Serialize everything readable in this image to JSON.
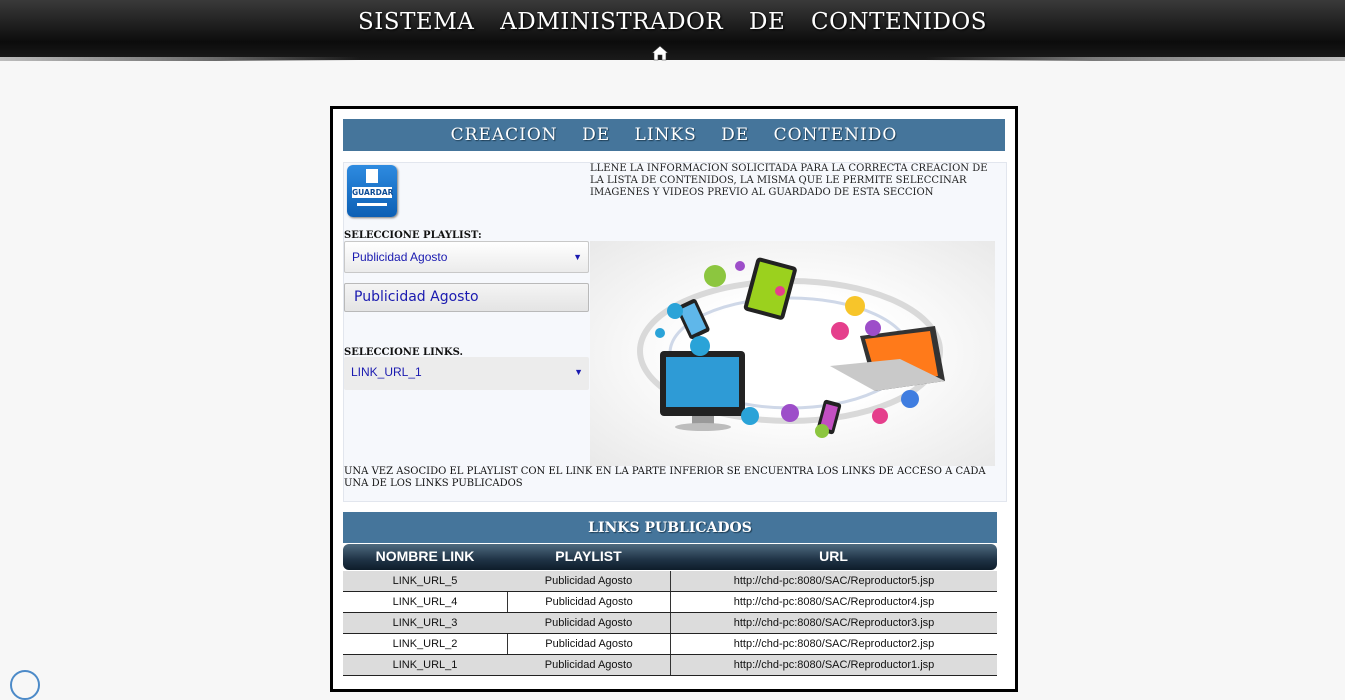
{
  "header": {
    "title": "SISTEMA ADMINISTRADOR DE CONTENIDOS",
    "home_icon": "home-icon"
  },
  "panel": {
    "title": "CREACION DE LINKS DE CONTENIDO",
    "save_button_label": "GUARDAR",
    "save_icon": "floppy-disk-icon",
    "info_text": "LLENE LA INFORMACION SOLICITADA PARA LA CORRECTA CREACION DE LA LISTA DE CONTENIDOS, LA MISMA QUE LE PERMITE SELECCINAR IMAGENES Y VIDEOS PREVIO AL GUARDADO DE ESTA SECCION",
    "playlist_label": "SELECCIONE PLAYLIST:",
    "playlist_selected": "Publicidad Agosto",
    "playlist_text": "Publicidad Agosto",
    "links_label": "SELECCIONE LINKS.",
    "links_selected": "LINK_URL_1",
    "footer_text": "UNA VEZ ASOCIDO EL PLAYLIST CON EL LINK EN LA PARTE INFERIOR SE ENCUENTRA LOS LINKS DE ACCESO A CADA UNA DE LOS LINKS PUBLICADOS"
  },
  "links_table": {
    "title": "LINKS PUBLICADOS",
    "columns": [
      "NOMBRE LINK",
      "PLAYLIST",
      "URL"
    ],
    "rows": [
      {
        "name": "LINK_URL_5",
        "playlist": "Publicidad Agosto",
        "url": "http://chd-pc:8080/SAC/Reproductor5.jsp"
      },
      {
        "name": "LINK_URL_4",
        "playlist": "Publicidad Agosto",
        "url": "http://chd-pc:8080/SAC/Reproductor4.jsp"
      },
      {
        "name": "LINK_URL_3",
        "playlist": "Publicidad Agosto",
        "url": "http://chd-pc:8080/SAC/Reproductor3.jsp"
      },
      {
        "name": "LINK_URL_2",
        "playlist": "Publicidad Agosto",
        "url": "http://chd-pc:8080/SAC/Reproductor2.jsp"
      },
      {
        "name": "LINK_URL_1",
        "playlist": "Publicidad Agosto",
        "url": "http://chd-pc:8080/SAC/Reproductor1.jsp"
      }
    ]
  },
  "colors": {
    "accent": "#45759b",
    "header_bg": "#0c0c0c",
    "select_text": "#1a1ab0"
  }
}
